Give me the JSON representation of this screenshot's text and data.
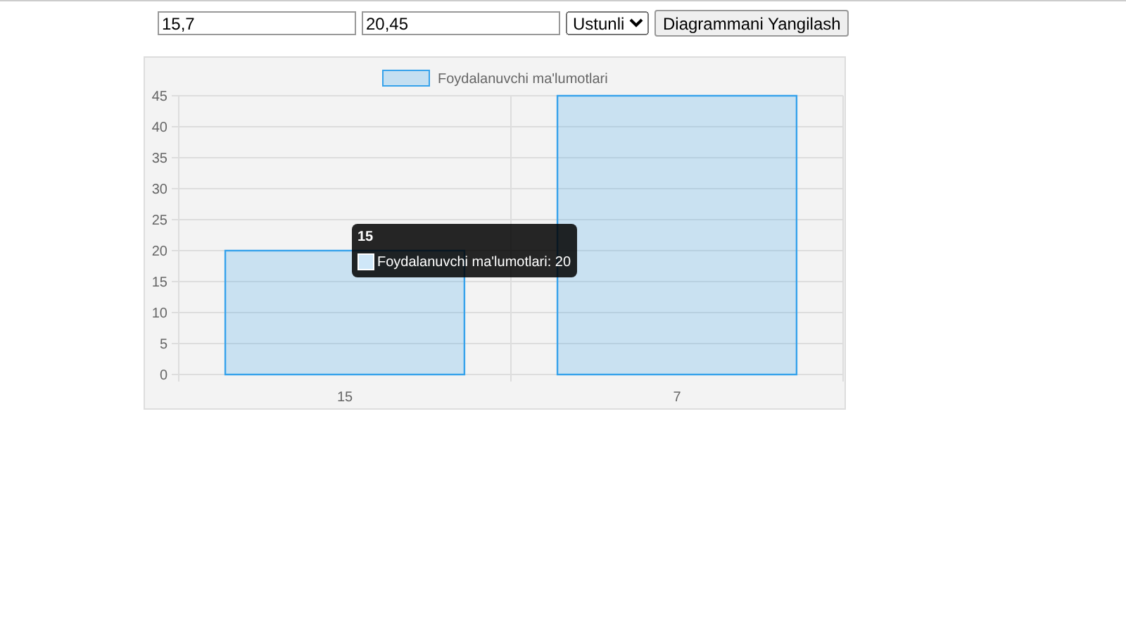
{
  "inputs": [
    {
      "value": "15,7"
    },
    {
      "value": "20,45"
    }
  ],
  "chart_type_select": {
    "value": "Ustunli"
  },
  "update_button": {
    "label": "Diagrammani Yangilash"
  },
  "chart": {
    "chart_data": {
      "type": "bar",
      "categories": [
        "15",
        "7"
      ],
      "series": [
        {
          "name": "Foydalanuvchi ma'lumotlari",
          "color": "#36a2eb",
          "values": [
            20,
            45
          ]
        }
      ],
      "ylim": [
        0,
        45
      ],
      "yticks": [
        0,
        5,
        10,
        15,
        20,
        25,
        30,
        35,
        40,
        45
      ],
      "grid": true
    },
    "tooltip": {
      "title": "15",
      "label": "Foydalanuvchi ma'lumotlari: 20"
    }
  }
}
